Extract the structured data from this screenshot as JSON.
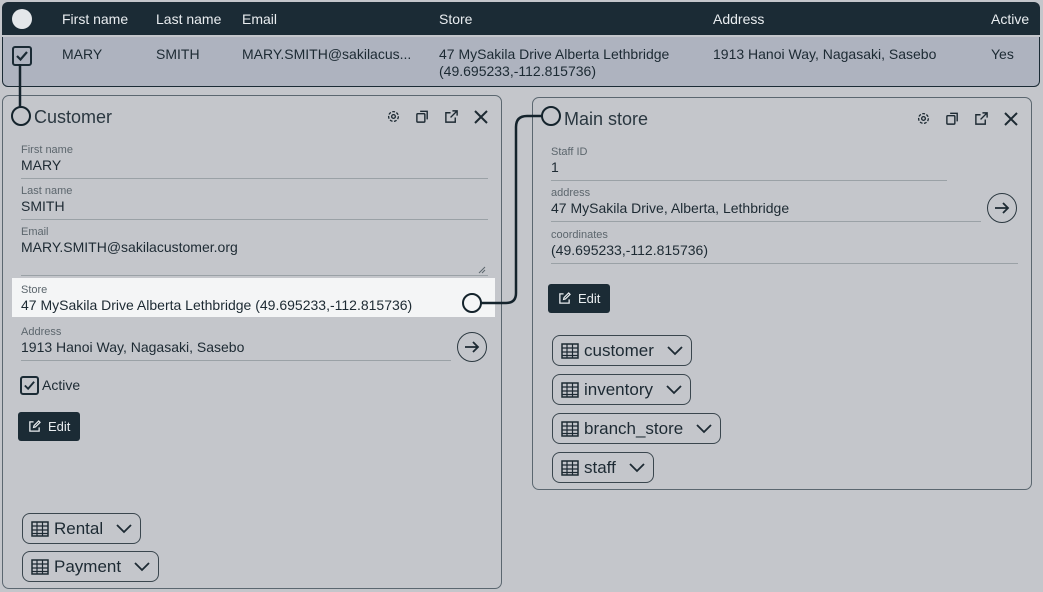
{
  "table": {
    "columns": [
      "First name",
      "Last name",
      "Email",
      "Store",
      "Address",
      "Active"
    ],
    "row": {
      "first_name": "MARY",
      "last_name": "SMITH",
      "email": "MARY.SMITH@sakilacus...",
      "store_line1": "47 MySakila Drive Alberta Lethbridge",
      "store_line2": "(49.695233,-112.815736)",
      "address": "1913 Hanoi Way, Nagasaki, Sasebo",
      "active": "Yes"
    }
  },
  "customer_panel": {
    "title": "Customer",
    "fields": {
      "first_name": {
        "label": "First name",
        "value": "MARY"
      },
      "last_name": {
        "label": "Last name",
        "value": "SMITH"
      },
      "email": {
        "label": "Email",
        "value": "MARY.SMITH@sakilacustomer.org"
      },
      "store": {
        "label": "Store",
        "value": "47 MySakila Drive Alberta Lethbridge (49.695233,-112.815736)"
      },
      "address": {
        "label": "Address",
        "value": "1913 Hanoi Way, Nagasaki, Sasebo"
      }
    },
    "active_label": "Active",
    "edit_label": "Edit",
    "relations": [
      "Rental",
      "Payment"
    ]
  },
  "store_panel": {
    "title": "Main store",
    "fields": {
      "staff_id": {
        "label": "Staff ID",
        "value": "1"
      },
      "address": {
        "label": "address",
        "value": "47 MySakila Drive, Alberta, Lethbridge"
      },
      "coordinates": {
        "label": "coordinates",
        "value": "(49.695233,-112.815736)"
      }
    },
    "edit_label": "Edit",
    "relations": [
      "customer",
      "inventory",
      "branch_store",
      "staff"
    ]
  },
  "icons": [
    "settings-icon",
    "copy-icon",
    "open-external-icon",
    "close-icon",
    "arrow-right-icon",
    "edit-icon",
    "table-icon",
    "chevron-down-icon",
    "checkbox-icon"
  ],
  "colors": {
    "dark": "#1b2b35",
    "background": "#c4c6cb",
    "selected_row": "#aeb3bf",
    "highlight_field": "#f4f5f6"
  }
}
